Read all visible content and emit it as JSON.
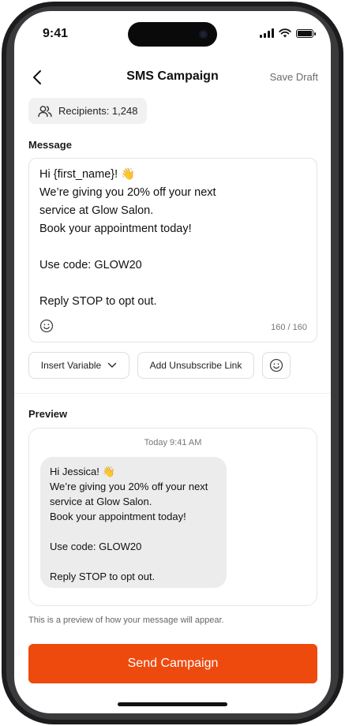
{
  "status": {
    "time": "9:41"
  },
  "nav": {
    "title": "SMS Campaign",
    "save_draft": "Save Draft"
  },
  "recipients": {
    "label": "Recipients: 1,248"
  },
  "message": {
    "label": "Message",
    "text": "Hi {first_name}! 👋\nWe’re giving you 20% off your next\nservice at Glow Salon.\nBook your appointment today!\n\nUse code: GLOW20\n\nReply STOP to opt out.",
    "char_count": "160 / 160"
  },
  "toolbar": {
    "insert_variable": "Insert Variable",
    "add_unsubscribe": "Add Unsubscribe Link"
  },
  "preview": {
    "label": "Preview",
    "timestamp": "Today 9:41 AM",
    "bubble_text": "Hi Jessica! 👋\nWe’re giving you 20% off your next\nservice at Glow Salon.\nBook your appointment today!\n\nUse code: GLOW20\n\nReply STOP to opt out.",
    "note": "This is a preview of how your message will appear."
  },
  "send": {
    "label": "Send Campaign"
  },
  "colors": {
    "accent": "#ee4a0e",
    "chip_bg": "#f1f1f1",
    "bubble_bg": "#ececec"
  }
}
